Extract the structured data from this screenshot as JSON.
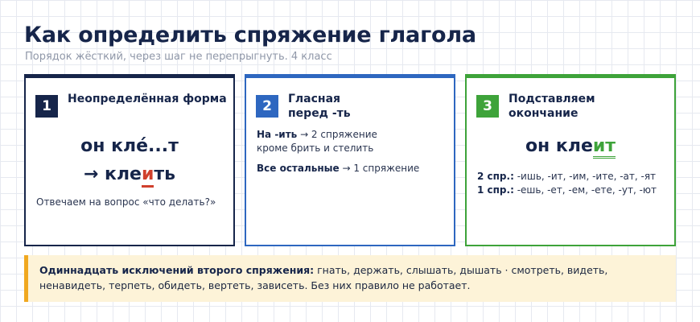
{
  "header": {
    "title": "Как определить спряжение глагола",
    "subtitle": "Порядок жёсткий, через шаг не перепрыгнуть. 4 класс"
  },
  "steps": [
    {
      "number": "1",
      "title": "Неопределённая форма",
      "word_line1": "он кле́...т",
      "word_line2_prefix": "→ кле",
      "word_line2_highlight": "и",
      "word_line2_suffix": "ть",
      "note": "Отвечаем на вопрос «что делать?»"
    },
    {
      "number": "2",
      "title": "Гласная перед -ть",
      "rule1_bold": "На -ить",
      "rule1_text": " → 2 спряжение",
      "rule1_line2": "кроме брить и стелить",
      "rule2_bold": "Все остальные",
      "rule2_text": " → 1 спряжение"
    },
    {
      "number": "3",
      "title": "Подставляем окончание",
      "word_prefix": "он кле",
      "word_highlight": "ит",
      "rule1_bold": "2 спр.:",
      "rule1_text": " -ишь, -ит, -им, -ите, -ат, -ят",
      "rule2_bold": "1 спр.:",
      "rule2_text": " -ешь, -ет, -ем, -ете, -ут, -ют"
    }
  ],
  "banner": {
    "bold": "Одиннадцать исключений второго спряжения:",
    "text": " гнать, держать, слышать, дышать · смотреть, видеть, ненавидеть, терпеть, обидеть, вертеть, зависеть. Без них правило не работает."
  },
  "colors": {
    "navy": "#16254a",
    "blue": "#2e67c0",
    "green": "#3ea33a",
    "red": "#d0402c",
    "amber": "#f0a820",
    "banner_bg": "#fdf3d8"
  }
}
